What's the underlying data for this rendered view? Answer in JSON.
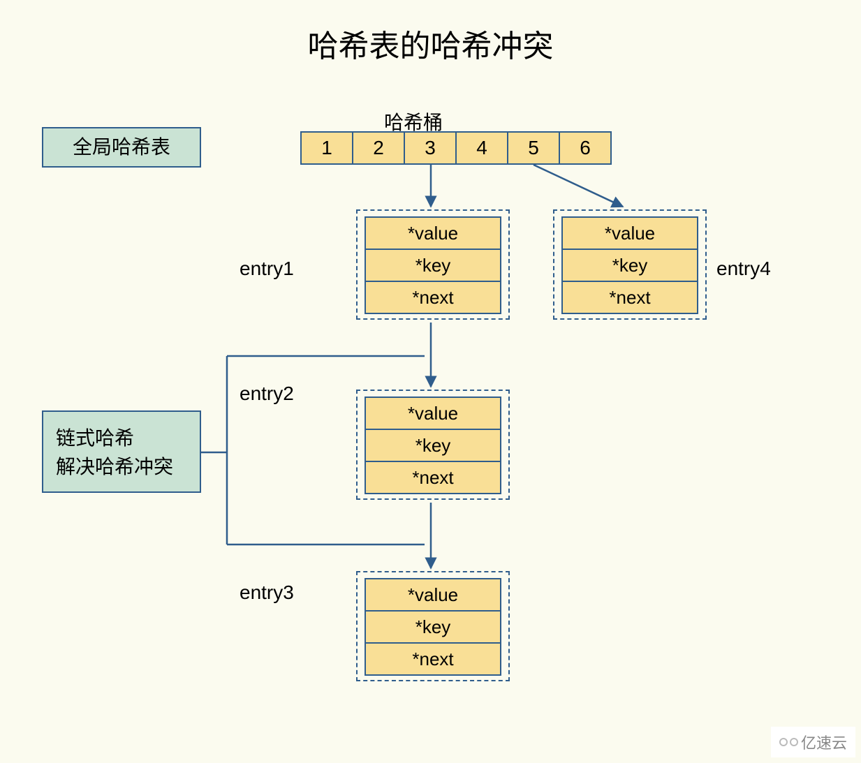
{
  "title": "哈希表的哈希冲突",
  "bucket_label": "哈希桶",
  "global_hash_label": "全局哈希表",
  "chain_hash_line1": "链式哈希",
  "chain_hash_line2": "解决哈希冲突",
  "buckets": [
    "1",
    "2",
    "3",
    "4",
    "5",
    "6"
  ],
  "entry_labels": {
    "entry1": "entry1",
    "entry2": "entry2",
    "entry3": "entry3",
    "entry4": "entry4"
  },
  "fields": {
    "value": "*value",
    "key": "*key",
    "next": "*next"
  },
  "watermark": "亿速云"
}
